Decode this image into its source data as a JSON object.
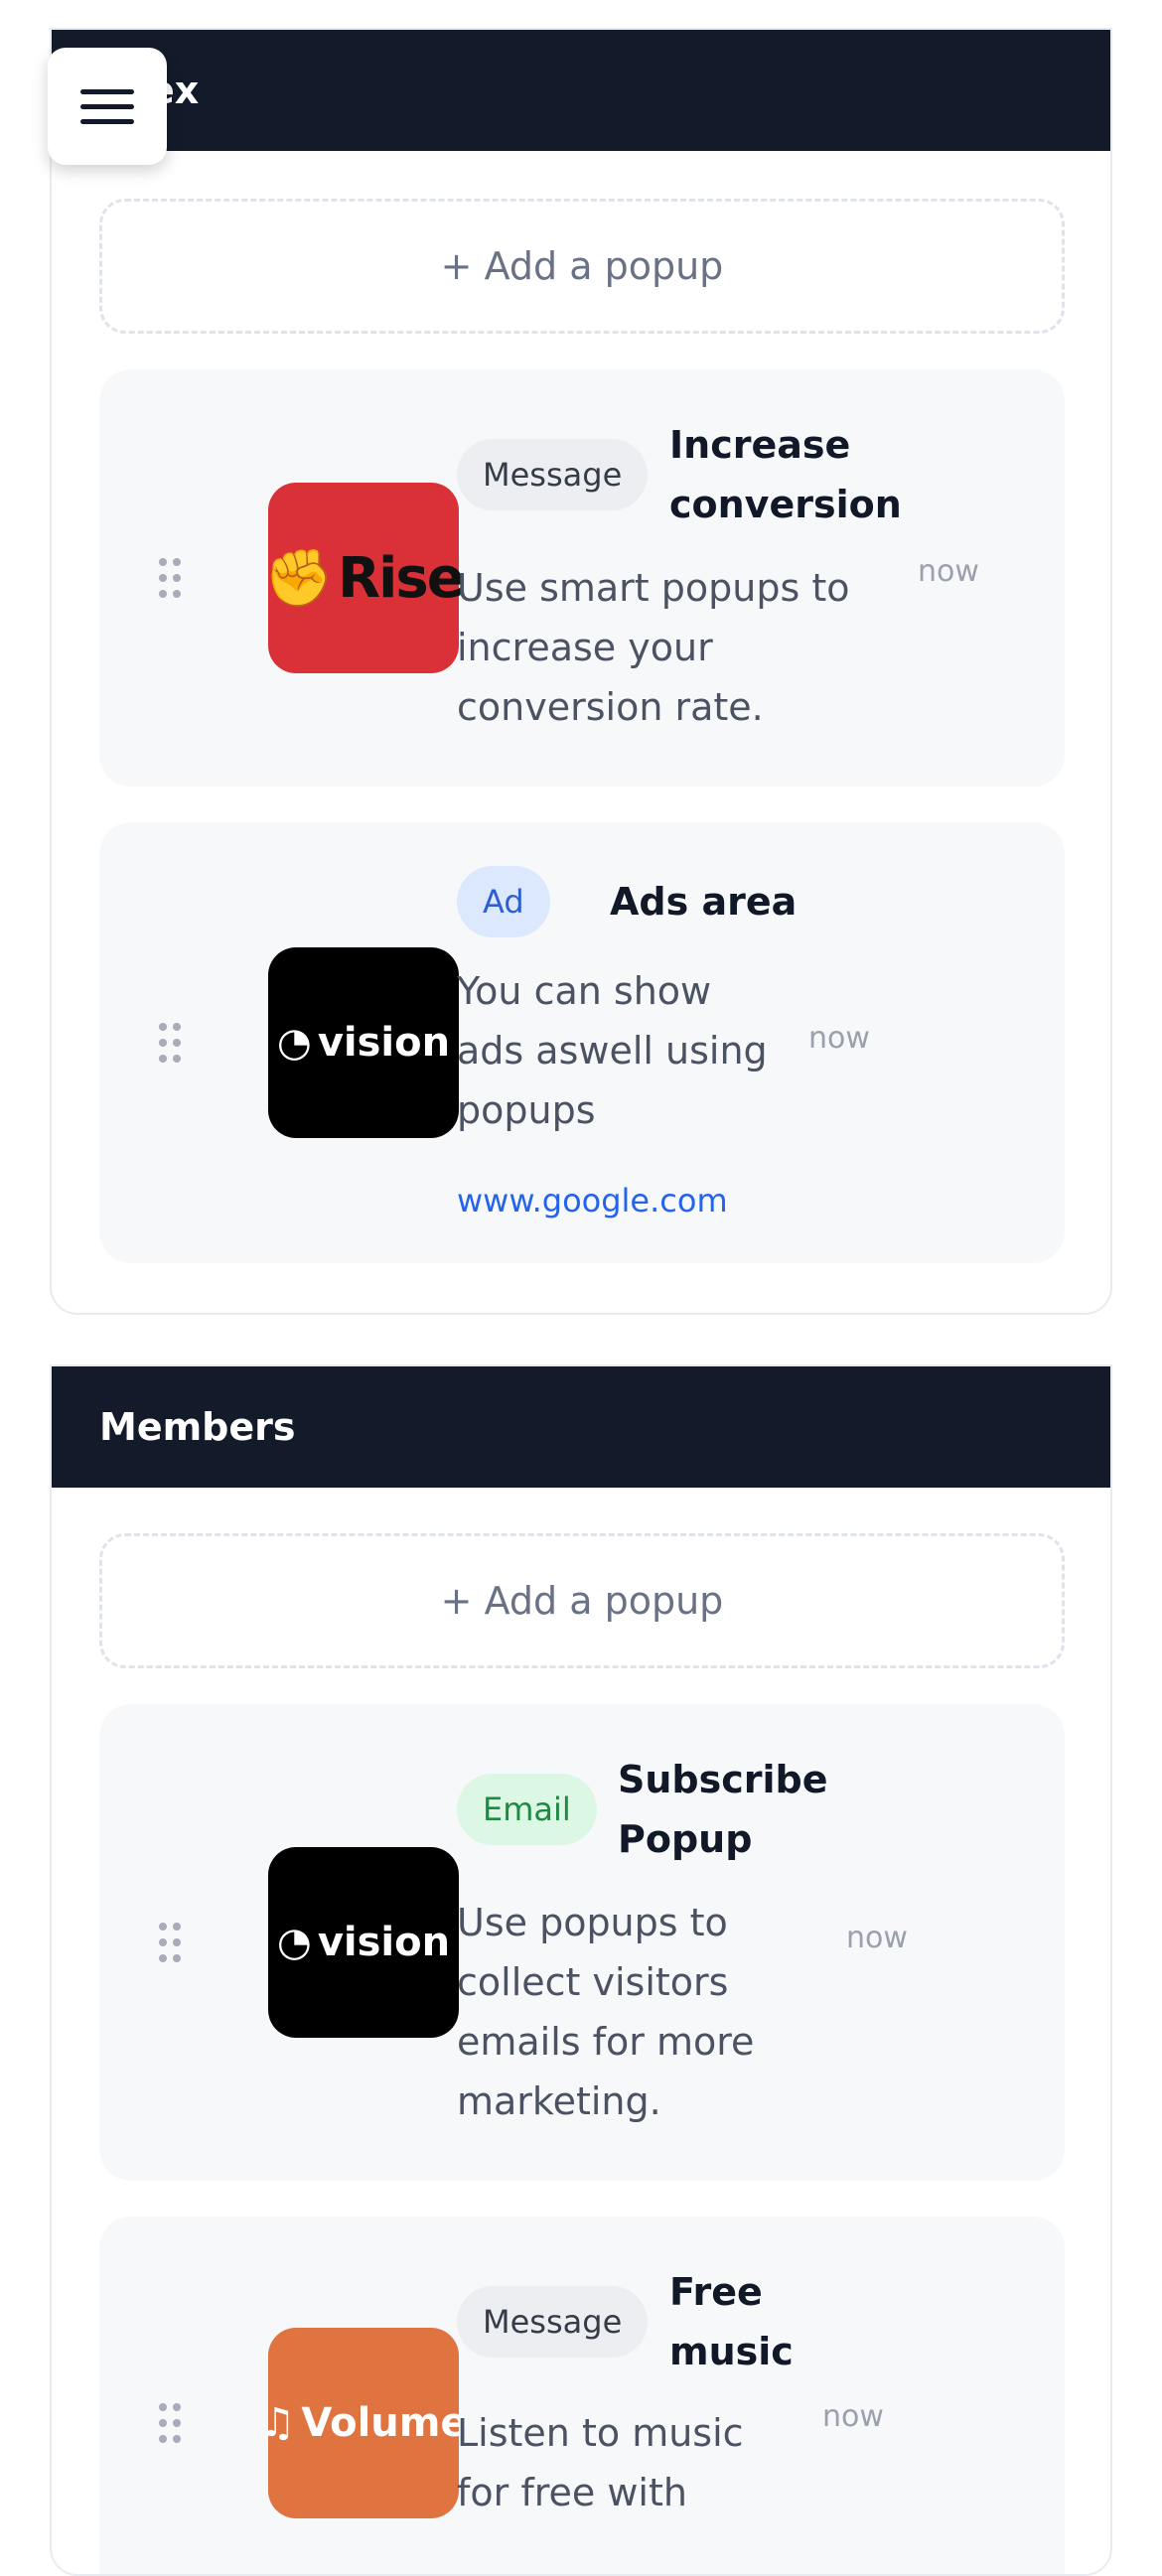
{
  "section1": {
    "title": "ex",
    "add_label": "+ Add a popup",
    "cards": [
      {
        "logo_text": "Rise",
        "logo_glyph": "fist-icon",
        "badge": "Message",
        "title": "Increase conversion",
        "description": "Use smart popups to increase your conversion rate.",
        "time": "now"
      },
      {
        "logo_text": "vision",
        "logo_glyph": "eye-icon",
        "badge": "Ad",
        "title": "Ads area",
        "description": "You can show ads aswell using popups",
        "link": "www.google.com",
        "time": "now"
      }
    ]
  },
  "section2": {
    "title": "Members",
    "add_label": "+ Add a popup",
    "cards": [
      {
        "logo_text": "vision",
        "logo_glyph": "eye-icon",
        "badge": "Email",
        "title": "Subscribe Popup",
        "description": "Use popups to collect visitors emails for more marketing.",
        "time": "now"
      },
      {
        "logo_text": "Volume",
        "logo_glyph": "music-note-icon",
        "badge": "Message",
        "title": "Free music",
        "description": "Listen to music for free with",
        "time": "now"
      }
    ]
  },
  "colors": {
    "header_bg": "#131a2a",
    "card_bg": "#f7f8fa",
    "link": "#2563eb",
    "rise_red": "#d93137",
    "volume_orange": "#e07440"
  }
}
